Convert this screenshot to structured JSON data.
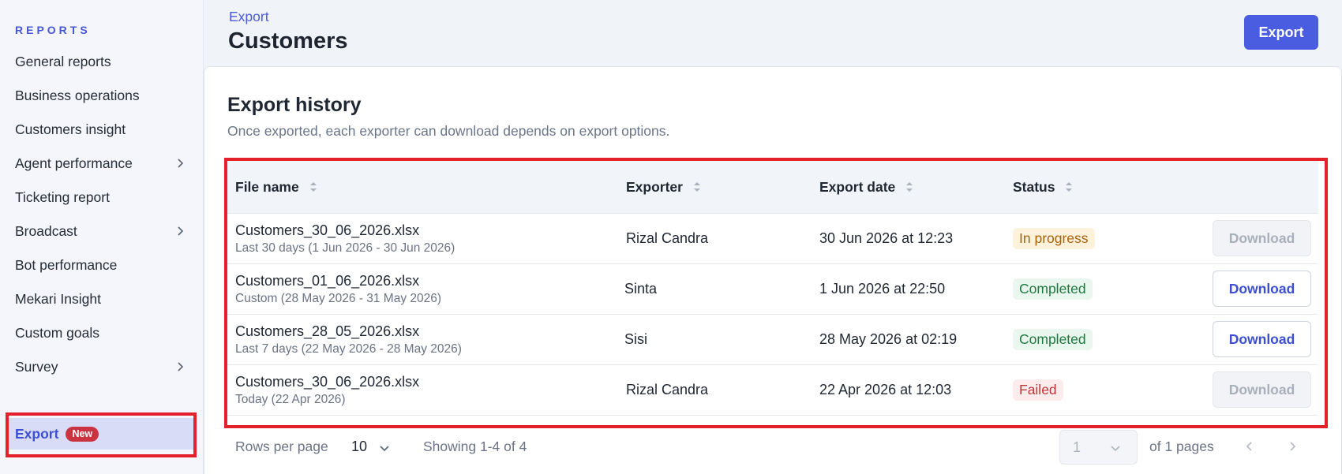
{
  "sidebar": {
    "heading": "REPORTS",
    "items": [
      {
        "label": "General reports"
      },
      {
        "label": "Business operations"
      },
      {
        "label": "Customers insight"
      },
      {
        "label": "Agent performance"
      },
      {
        "label": "Ticketing report"
      },
      {
        "label": "Broadcast"
      },
      {
        "label": "Bot performance"
      },
      {
        "label": "Mekari Insight"
      },
      {
        "label": "Custom goals"
      },
      {
        "label": "Survey"
      },
      {
        "label": "Export",
        "badge": "New"
      }
    ]
  },
  "header": {
    "breadcrumb": "Export",
    "title": "Customers",
    "export_label": "Export"
  },
  "card": {
    "title": "Export history",
    "subtitle": "Once exported, each exporter can download depends on export options."
  },
  "table": {
    "columns": [
      "File name",
      "Exporter",
      "Export date",
      "Status"
    ],
    "rows": [
      {
        "file": "Customers_30_06_2026.xlsx",
        "range": "Last 30 days (1 Jun 2026 - 30 Jun 2026)",
        "exporter": "Rizal Candra",
        "date": "30 Jun 2026 at 12:23",
        "status": "In progress",
        "action": "Download"
      },
      {
        "file": "Customers_01_06_2026.xlsx",
        "range": "Custom (28 May 2026 - 31 May 2026)",
        "exporter": "Sinta",
        "date": "1 Jun 2026 at 22:50",
        "status": "Completed",
        "action": "Download"
      },
      {
        "file": "Customers_28_05_2026.xlsx",
        "range": "Last 7 days (22 May 2026 - 28 May 2026)",
        "exporter": "Sisi",
        "date": "28 May 2026 at 02:19",
        "status": "Completed",
        "action": "Download"
      },
      {
        "file": "Customers_30_06_2026.xlsx",
        "range": "Today (22 Apr 2026)",
        "exporter": "Rizal Candra",
        "date": "22 Apr 2026 at 12:03",
        "status": "Failed",
        "action": "Download"
      }
    ]
  },
  "footer": {
    "rows_per_page_label": "Rows per page",
    "rows_per_page_value": "10",
    "showing": "Showing 1-4 of 4",
    "page_value": "1",
    "of_pages": "of 1 pages"
  },
  "colors": {
    "accent": "#4a5ce0",
    "highlight": "#e4202b"
  }
}
